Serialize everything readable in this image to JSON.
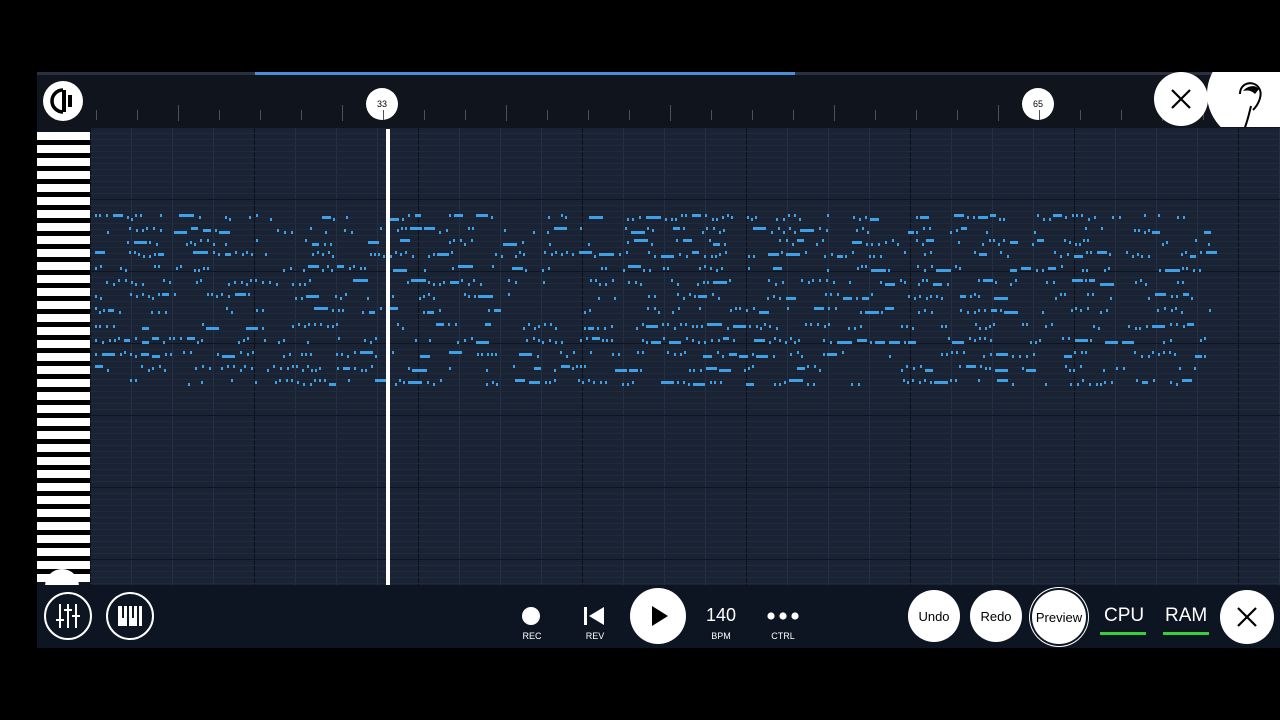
{
  "ruler": {
    "markers": [
      "33",
      "65"
    ]
  },
  "transport": {
    "rec_label": "REC",
    "rev_label": "REV",
    "bpm_value": "140",
    "bpm_label": "BPM",
    "ctrl_label": "CTRL"
  },
  "actions": {
    "undo": "Undo",
    "redo": "Redo",
    "preview": "Preview"
  },
  "meters": {
    "cpu": "CPU",
    "ram": "RAM"
  },
  "colors": {
    "note": "#3fa0e6",
    "meter": "#36d13a",
    "grid": "#1a2333"
  },
  "icons": [
    "logo-icon",
    "close-icon",
    "fl-studio-fruit-icon",
    "chevron-left-icon",
    "mixer-icon",
    "piano-keys-icon",
    "record-icon",
    "skip-back-icon",
    "play-icon",
    "more-dots-icon"
  ]
}
